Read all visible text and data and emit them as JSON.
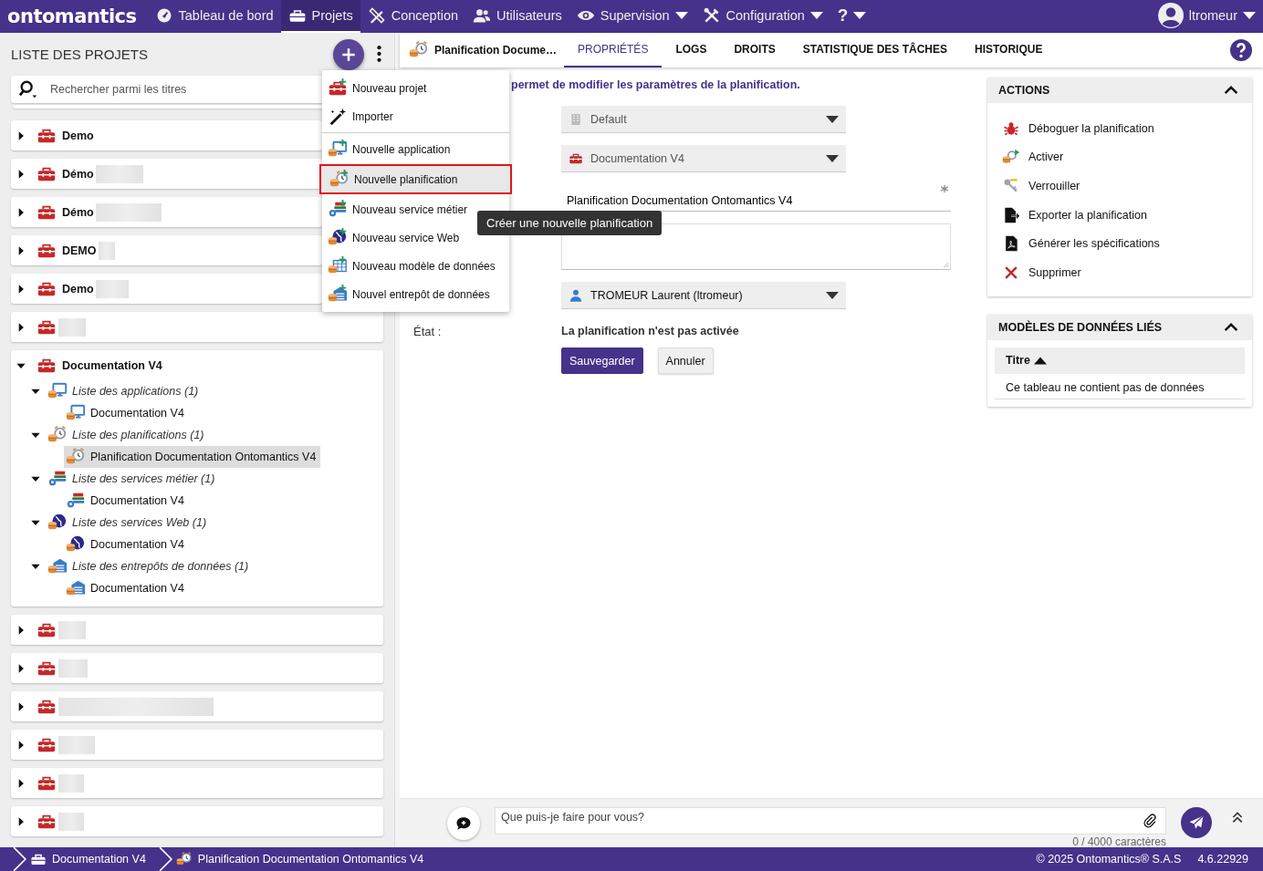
{
  "nav": {
    "logo": "ontomantics",
    "items": [
      {
        "label": "Tableau de bord",
        "selected": false
      },
      {
        "label": "Projets",
        "selected": true
      },
      {
        "label": "Conception",
        "selected": false
      },
      {
        "label": "Utilisateurs",
        "selected": false
      },
      {
        "label": "Supervision",
        "selected": false,
        "caret": true
      },
      {
        "label": "Configuration",
        "selected": false,
        "caret": true
      },
      {
        "label": "?",
        "selected": false,
        "caret": true
      }
    ],
    "user": {
      "name": "ltromeur",
      "caret": true
    }
  },
  "project_list": {
    "title": "LISTE DES PROJETS",
    "search": {
      "placeholder": "Rechercher parmi les titres"
    },
    "projects": [
      {
        "name": "Demo",
        "expanded": false
      },
      {
        "name": "Démo",
        "redacted": true,
        "expanded": false
      },
      {
        "name": "Démo",
        "redacted": true,
        "expanded": false
      },
      {
        "name": "DEMO",
        "redacted": true,
        "expanded": false
      },
      {
        "name": "Demo",
        "redacted": true,
        "expanded": false
      },
      {
        "redacted": true,
        "expanded": false
      },
      {
        "name": "Documentation V4",
        "expanded": true,
        "children": [
          {
            "label": "Liste des applications (1)",
            "expanded": true,
            "children": [
              {
                "label": "Documentation V4",
                "selected": false
              }
            ]
          },
          {
            "label": "Liste des planifications (1)",
            "expanded": true,
            "children": [
              {
                "label": "Planification Documentation Ontomantics V4",
                "selected": true
              }
            ]
          },
          {
            "label": "Liste des services métier (1)",
            "expanded": true,
            "children": [
              {
                "label": "Documentation V4",
                "selected": false
              }
            ]
          },
          {
            "label": "Liste des services Web (1)",
            "expanded": true,
            "children": [
              {
                "label": "Documentation V4",
                "selected": false
              }
            ]
          },
          {
            "label": "Liste des entrepôts de données (1)",
            "expanded": true,
            "children": [
              {
                "label": "Documentation V4",
                "selected": false
              }
            ]
          }
        ]
      },
      {
        "redacted": true,
        "expanded": false
      },
      {
        "redacted": true,
        "expanded": false
      },
      {
        "redacted": true,
        "expanded": false
      },
      {
        "redacted": true,
        "expanded": false
      },
      {
        "redacted": true,
        "expanded": false
      },
      {
        "redacted": true,
        "expanded": false
      }
    ]
  },
  "add_menu": {
    "items": [
      {
        "label": "Nouveau projet",
        "selected": false
      },
      {
        "label": "Importer",
        "selected": false
      },
      {
        "label": "Nouvelle application",
        "selected": false,
        "separator_before": true
      },
      {
        "label": "Nouvelle planification",
        "selected": true
      },
      {
        "label": "Nouveau service métier",
        "selected": false
      },
      {
        "label": "Nouveau service Web",
        "selected": false
      },
      {
        "label": "Nouveau modèle de données",
        "selected": false
      },
      {
        "label": "Nouvel entrepôt de données",
        "selected": false
      }
    ]
  },
  "tooltip": {
    "text": "Créer une nouvelle planification"
  },
  "tabs": {
    "title": {
      "label": "Planification Docume…"
    },
    "items": [
      {
        "label": "PROPRIÉTÉS",
        "selected": true
      },
      {
        "label": "LOGS",
        "selected": false
      },
      {
        "label": "DROITS",
        "selected": false
      },
      {
        "label": "STATISTIQUE DES TÂCHES",
        "selected": false
      },
      {
        "label": "HISTORIQUE",
        "selected": false
      }
    ]
  },
  "form": {
    "description": "permet de modifier les paramètres de la planification.",
    "fields": [
      {
        "kind": "select",
        "value": "Default",
        "disabled": true
      },
      {
        "kind": "select",
        "value": "Documentation V4",
        "disabled": true
      },
      {
        "kind": "text",
        "value": "Planification Documentation Ontomantics V4",
        "required": true
      },
      {
        "kind": "textarea"
      },
      {
        "kind": "select",
        "value": "TROMEUR Laurent (ltromeur)",
        "disabled": false
      }
    ],
    "state": {
      "label": "État :",
      "value": "La planification n'est pas activée"
    },
    "buttons": [
      {
        "label": "Sauvegarder",
        "kind": "primary"
      },
      {
        "label": "Annuler",
        "kind": "secondary"
      }
    ]
  },
  "actions_panel": {
    "title": "ACTIONS",
    "expanded": true,
    "items": [
      {
        "label": "Déboguer la planification"
      },
      {
        "label": "Activer"
      },
      {
        "label": "Verrouiller"
      },
      {
        "label": "Exporter la planification"
      },
      {
        "label": "Générer les spécifications"
      },
      {
        "label": "Supprimer"
      }
    ]
  },
  "models_panel": {
    "title": "MODÈLES DE DONNÉES LIÉS",
    "expanded": true,
    "table": {
      "columns": [
        {
          "label": "Titre",
          "sorted": true
        }
      ],
      "empty_message": "Ce tableau ne contient pas de données"
    }
  },
  "chat": {
    "placeholder": "Que puis-je faire pour vous?",
    "counter": "0 / 4000 caractères"
  },
  "footer": {
    "breadcrumb": [
      {
        "label": "Documentation V4"
      },
      {
        "label": "Planification Documentation Ontomantics V4"
      }
    ],
    "copyright": "© 2025 Ontomantics® S.A.S",
    "version": "4.6.22929"
  }
}
